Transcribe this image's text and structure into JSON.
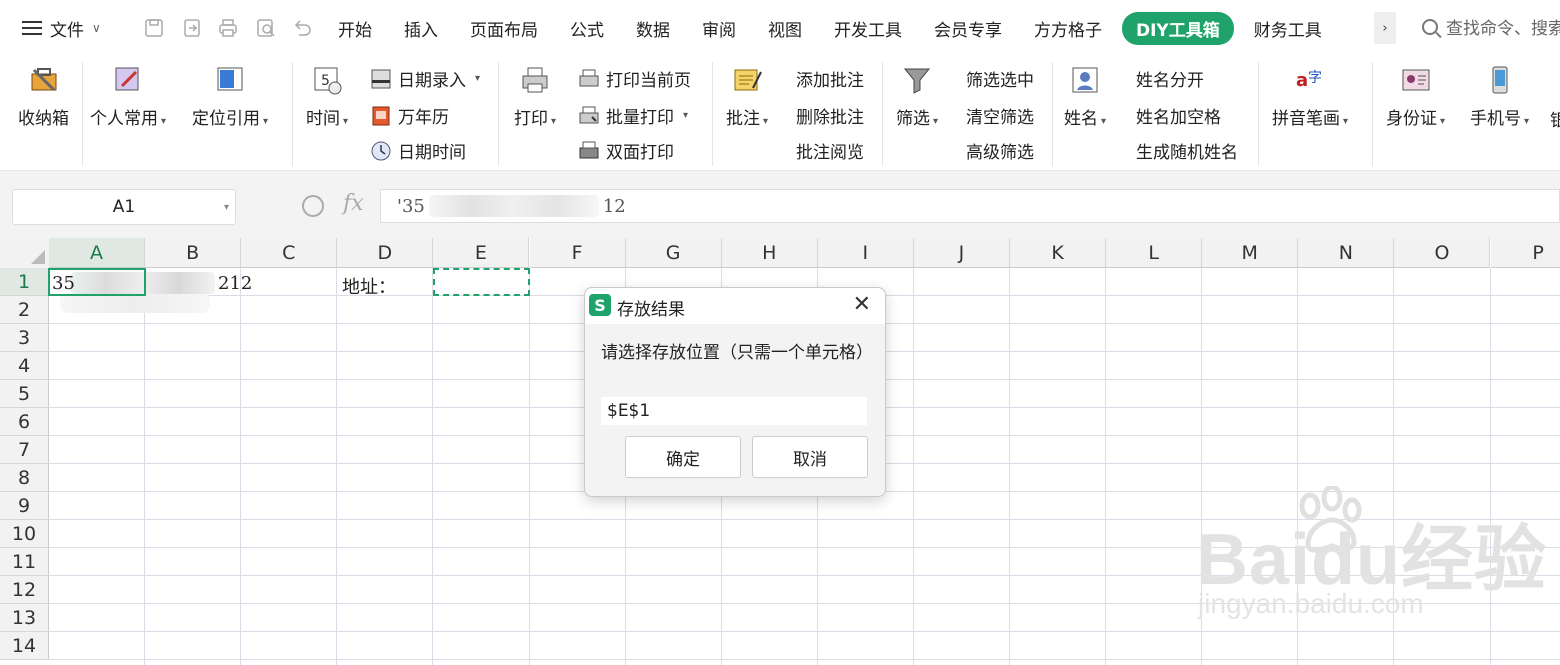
{
  "menubar": {
    "file_label": "文件",
    "tabs": [
      "开始",
      "插入",
      "页面布局",
      "公式",
      "数据",
      "审阅",
      "视图",
      "开发工具",
      "会员专享",
      "方方格子",
      "DIY工具箱",
      "财务工具"
    ],
    "active_tab": "DIY工具箱",
    "more_label": "›",
    "search_text": "查找命令、搜索"
  },
  "ribbon": {
    "shoubox": "收纳箱",
    "personal": "个人常用",
    "locate": "定位引用",
    "time": "时间",
    "date_input": "日期录入",
    "calendar": "万年历",
    "datetime": "日期时间",
    "print": "打印",
    "print_current": "打印当前页",
    "batch_print": "批量打印",
    "duplex_print": "双面打印",
    "comment": "批注",
    "add_comment": "添加批注",
    "delete_comment": "删除批注",
    "view_comment": "批注阅览",
    "filter": "筛选",
    "filter_selected": "筛选选中",
    "clear_filter": "清空筛选",
    "advanced_filter": "高级筛选",
    "name": "姓名",
    "split_name": "姓名分开",
    "name_space": "姓名加空格",
    "random_name": "生成随机姓名",
    "pinyin": "拼音笔画",
    "idcard": "身份证",
    "phone": "手机号",
    "cut": "银"
  },
  "formula_bar": {
    "name_box": "A1",
    "fx": "fx",
    "value_prefix": "'35",
    "value_suffix": "12"
  },
  "sheet": {
    "columns": [
      "A",
      "B",
      "C",
      "D",
      "E",
      "F",
      "G",
      "H",
      "I",
      "J",
      "K",
      "L",
      "M",
      "N",
      "O",
      "P"
    ],
    "rows": [
      "1",
      "2",
      "3",
      "4",
      "5",
      "6",
      "7",
      "8",
      "9",
      "10",
      "11",
      "12",
      "13",
      "14"
    ],
    "a1_prefix": "35",
    "b1_suffix": "212",
    "d1_text": "地址："
  },
  "dialog": {
    "icon_label": "S",
    "title": "存放结果",
    "prompt": "请选择存放位置（只需一个单元格）",
    "input_value": "$E$1",
    "ok_label": "确定",
    "cancel_label": "取消"
  },
  "watermark": {
    "brand": "Baidu经验",
    "url": "jingyan.baidu.com"
  },
  "colors": {
    "accent": "#1fa36a"
  }
}
